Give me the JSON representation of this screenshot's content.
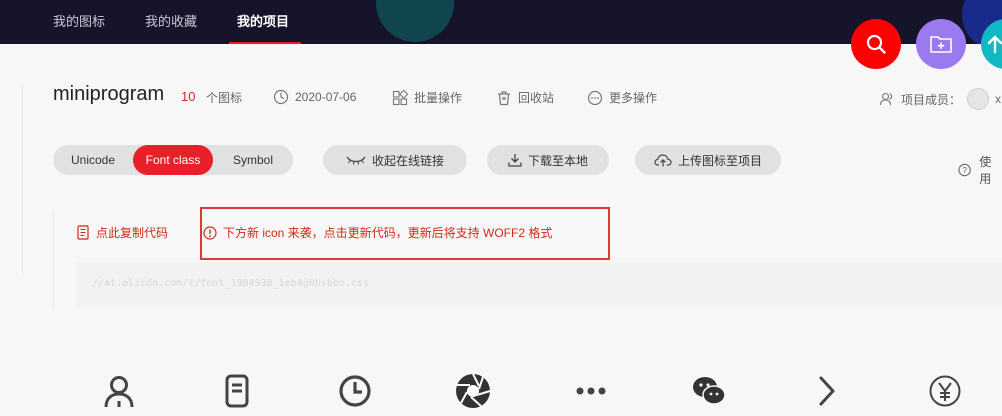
{
  "nav": {
    "items": [
      {
        "label": "我的图标"
      },
      {
        "label": "我的收藏"
      },
      {
        "label": "我的项目"
      }
    ]
  },
  "project": {
    "name": "miniprogram",
    "icon_count": "10",
    "icon_count_label": "个图标",
    "date": "2020-07-06",
    "batch_label": "批量操作",
    "recycle_label": "回收站",
    "more_label": "更多操作",
    "members_label": "项目成员：",
    "member_initial": "x"
  },
  "toolbar": {
    "tabs": [
      {
        "label": "Unicode"
      },
      {
        "label": "Font class"
      },
      {
        "label": "Symbol"
      }
    ],
    "active_tab": "Font class",
    "collapse_label": "收起在线链接",
    "download_label": "下载至本地",
    "upload_label": "上传图标至项目",
    "help_label": "使用"
  },
  "notice": {
    "copy_label": "点此复制代码",
    "message": "下方新 icon 来袭，点击更新代码，更新后将支持 WOFF2 格式",
    "code": "//at.alicdn.com/t/font_1984938_1eb4g0bsbbo.css"
  },
  "colors": {
    "accent": "#e8202a",
    "nav_bg": "#15142b",
    "fab_search": "#ff0000",
    "fab_folder": "#9b7af0",
    "fab_up": "#12b7c4"
  },
  "bottom_icons": [
    "user-icon",
    "phone-icon",
    "clock-icon",
    "aperture-icon",
    "more-dots-icon",
    "wechat-icon",
    "chevron-right-icon",
    "yen-icon"
  ]
}
